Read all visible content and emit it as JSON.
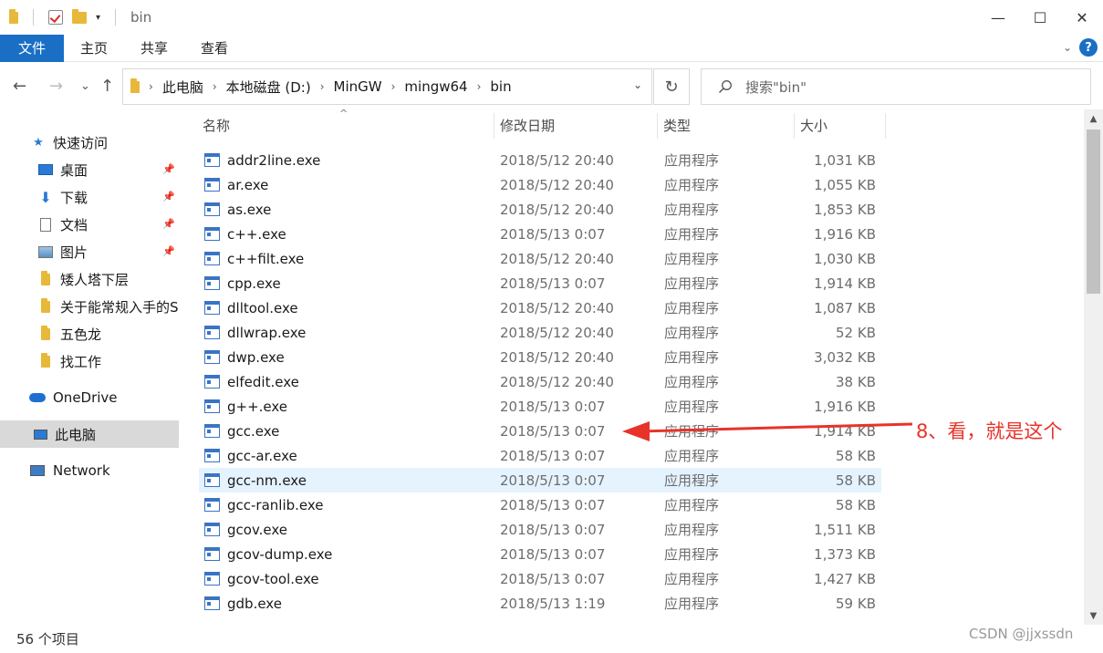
{
  "window": {
    "title": "bin",
    "minimize": "—",
    "maximize": "☐",
    "close": "✕",
    "qat_dropdown": "▾"
  },
  "ribbon": {
    "tabs": [
      "文件",
      "主页",
      "共享",
      "查看"
    ],
    "expand": "⌄",
    "help": "?"
  },
  "nav": {
    "back": "←",
    "forward": "→",
    "recent": "⌄",
    "up": "↑",
    "breadcrumb": [
      "此电脑",
      "本地磁盘 (D:)",
      "MinGW",
      "mingw64",
      "bin"
    ],
    "separator": "›",
    "dropdown": "⌄",
    "refresh": "↻",
    "search_placeholder": "搜索\"bin\""
  },
  "sidebar": {
    "items": [
      {
        "label": "快速访问",
        "icon": "star-icon",
        "pinned": false
      },
      {
        "label": "桌面",
        "icon": "desktop-icon",
        "pinned": true
      },
      {
        "label": "下载",
        "icon": "download-icon",
        "pinned": true
      },
      {
        "label": "文档",
        "icon": "document-icon",
        "pinned": true
      },
      {
        "label": "图片",
        "icon": "pictures-icon",
        "pinned": true
      },
      {
        "label": "矮人塔下层",
        "icon": "folder-icon",
        "pinned": false
      },
      {
        "label": "关于能常规入手的S",
        "icon": "folder-icon",
        "pinned": false
      },
      {
        "label": "五色龙",
        "icon": "folder-icon",
        "pinned": false
      },
      {
        "label": "找工作",
        "icon": "folder-icon",
        "pinned": false
      },
      {
        "label": "OneDrive",
        "icon": "cloud-icon",
        "pinned": false
      },
      {
        "label": "此电脑",
        "icon": "computer-icon",
        "pinned": false
      },
      {
        "label": "Network",
        "icon": "network-icon",
        "pinned": false
      }
    ]
  },
  "columns": {
    "name": "名称",
    "date": "修改日期",
    "type": "类型",
    "size": "大小"
  },
  "files": [
    {
      "name": "addr2line.exe",
      "date": "2018/5/12 20:40",
      "type": "应用程序",
      "size": "1,031 KB"
    },
    {
      "name": "ar.exe",
      "date": "2018/5/12 20:40",
      "type": "应用程序",
      "size": "1,055 KB"
    },
    {
      "name": "as.exe",
      "date": "2018/5/12 20:40",
      "type": "应用程序",
      "size": "1,853 KB"
    },
    {
      "name": "c++.exe",
      "date": "2018/5/13 0:07",
      "type": "应用程序",
      "size": "1,916 KB"
    },
    {
      "name": "c++filt.exe",
      "date": "2018/5/12 20:40",
      "type": "应用程序",
      "size": "1,030 KB"
    },
    {
      "name": "cpp.exe",
      "date": "2018/5/13 0:07",
      "type": "应用程序",
      "size": "1,914 KB"
    },
    {
      "name": "dlltool.exe",
      "date": "2018/5/12 20:40",
      "type": "应用程序",
      "size": "1,087 KB"
    },
    {
      "name": "dllwrap.exe",
      "date": "2018/5/12 20:40",
      "type": "应用程序",
      "size": "52 KB"
    },
    {
      "name": "dwp.exe",
      "date": "2018/5/12 20:40",
      "type": "应用程序",
      "size": "3,032 KB"
    },
    {
      "name": "elfedit.exe",
      "date": "2018/5/12 20:40",
      "type": "应用程序",
      "size": "38 KB"
    },
    {
      "name": "g++.exe",
      "date": "2018/5/13 0:07",
      "type": "应用程序",
      "size": "1,916 KB"
    },
    {
      "name": "gcc.exe",
      "date": "2018/5/13 0:07",
      "type": "应用程序",
      "size": "1,914 KB"
    },
    {
      "name": "gcc-ar.exe",
      "date": "2018/5/13 0:07",
      "type": "应用程序",
      "size": "58 KB"
    },
    {
      "name": "gcc-nm.exe",
      "date": "2018/5/13 0:07",
      "type": "应用程序",
      "size": "58 KB"
    },
    {
      "name": "gcc-ranlib.exe",
      "date": "2018/5/13 0:07",
      "type": "应用程序",
      "size": "58 KB"
    },
    {
      "name": "gcov.exe",
      "date": "2018/5/13 0:07",
      "type": "应用程序",
      "size": "1,511 KB"
    },
    {
      "name": "gcov-dump.exe",
      "date": "2018/5/13 0:07",
      "type": "应用程序",
      "size": "1,373 KB"
    },
    {
      "name": "gcov-tool.exe",
      "date": "2018/5/13 0:07",
      "type": "应用程序",
      "size": "1,427 KB"
    },
    {
      "name": "gdb.exe",
      "date": "2018/5/13 1:19",
      "type": "应用程序",
      "size": "59 KB"
    }
  ],
  "status": {
    "count": "56 个项目"
  },
  "annotation": {
    "text": "8、看，就是这个",
    "color": "#e8332a"
  },
  "watermark": "CSDN @jjxssdn",
  "colors": {
    "accent": "#1a6fc5",
    "hover_row": "#e5f3ff",
    "selected_nav": "#d9d9d9"
  }
}
